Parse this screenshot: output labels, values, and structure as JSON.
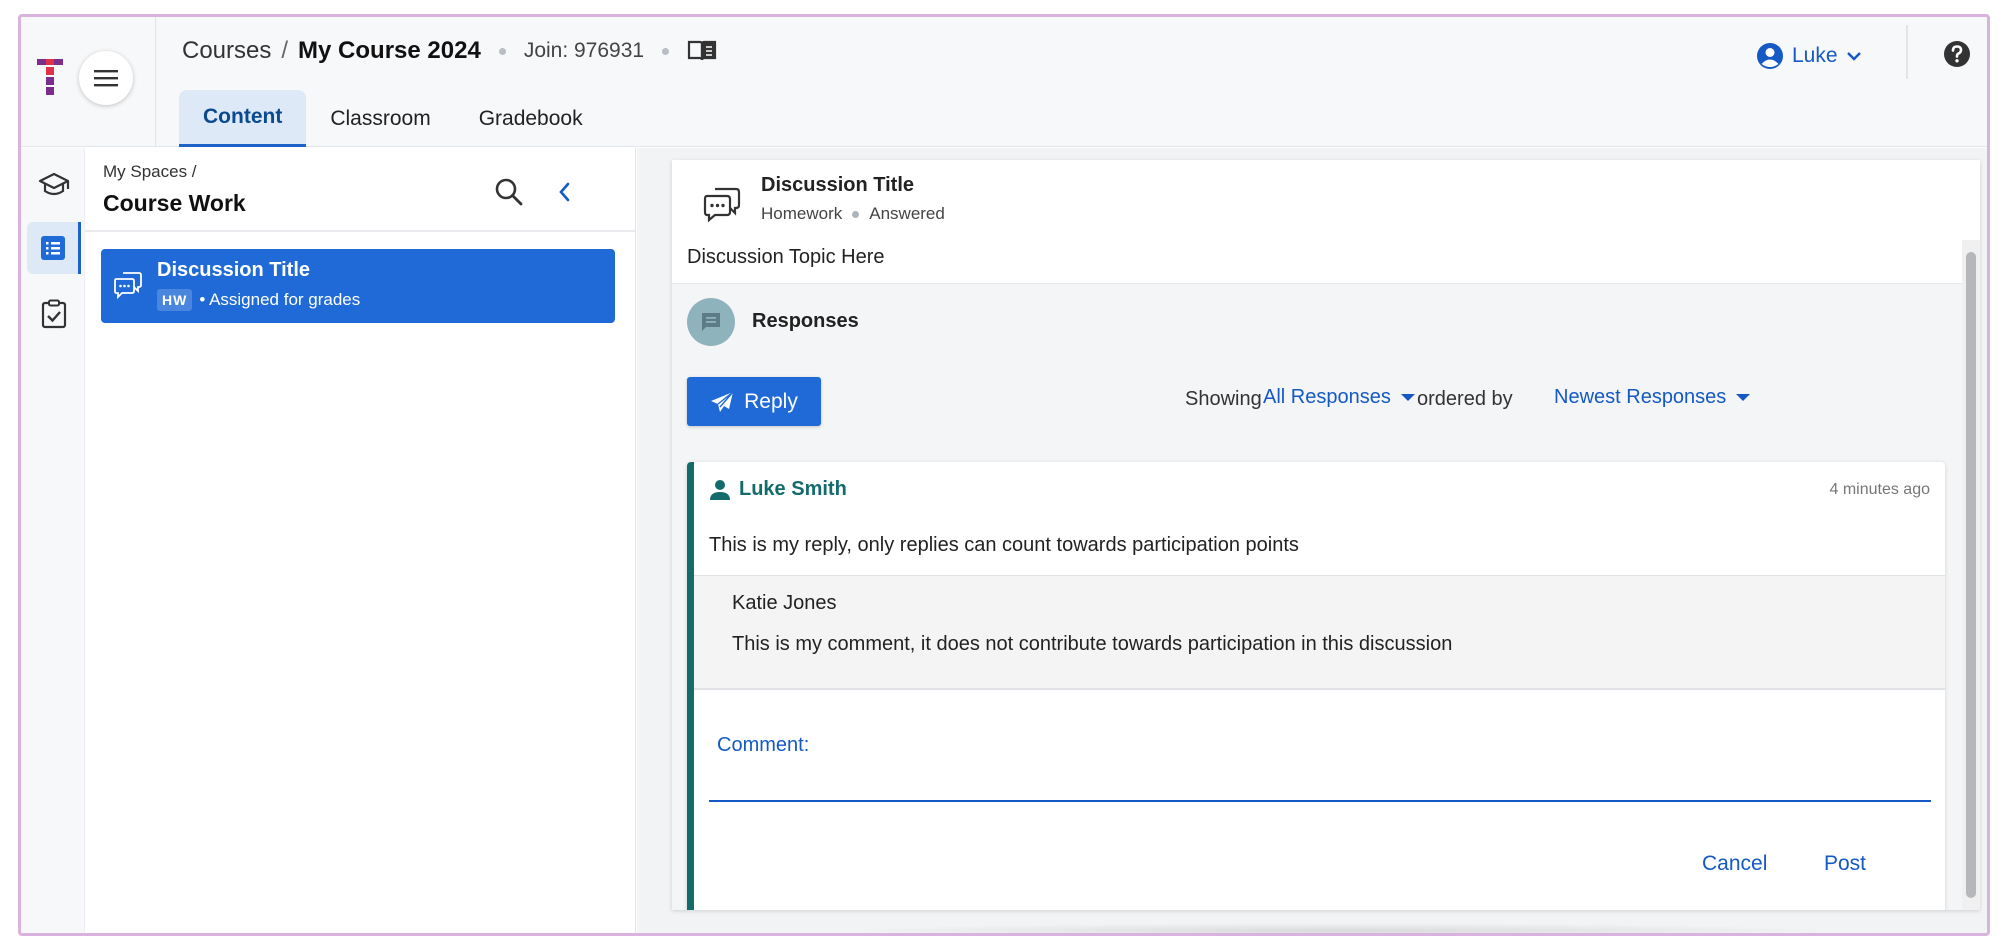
{
  "header": {
    "breadcrumb_root": "Courses",
    "breadcrumb_sep": "/",
    "course_name": "My Course 2024",
    "join_code": "Join: 976931",
    "tabs": [
      {
        "label": "Content",
        "active": true
      },
      {
        "label": "Classroom",
        "active": false
      },
      {
        "label": "Gradebook",
        "active": false
      }
    ],
    "user_name": "Luke"
  },
  "rail": {
    "items": [
      {
        "icon": "graduation-cap-icon",
        "active": false
      },
      {
        "icon": "list-icon",
        "active": true
      },
      {
        "icon": "clipboard-check-icon",
        "active": false
      }
    ]
  },
  "sidebar": {
    "crumb": "My Spaces  /",
    "title": "Course Work",
    "item": {
      "title": "Discussion Title",
      "badge": "HW",
      "meta": "•  Assigned for grades"
    }
  },
  "discussion": {
    "title": "Discussion Title",
    "type": "Homework",
    "status": "Answered",
    "topic": "Discussion Topic Here",
    "responses_label": "Responses",
    "reply_label": "Reply",
    "showing_label": "Showing",
    "filter_value": "All Responses",
    "ordered_label": "ordered by",
    "order_value": "Newest Responses"
  },
  "response": {
    "author": "Luke Smith",
    "time": "4 minutes ago",
    "body": "This is my reply, only replies can count towards participation points",
    "comment": {
      "author": "Katie Jones",
      "body": "This is my comment, it does not contribute towards participation in this discussion"
    },
    "comment_label": "Comment:",
    "comment_value": "",
    "cancel_label": "Cancel",
    "post_label": "Post"
  },
  "colors": {
    "accent": "#1f6ad6",
    "link": "#1459c4",
    "teal": "#146b6b",
    "frame": "#d9b3dd"
  }
}
